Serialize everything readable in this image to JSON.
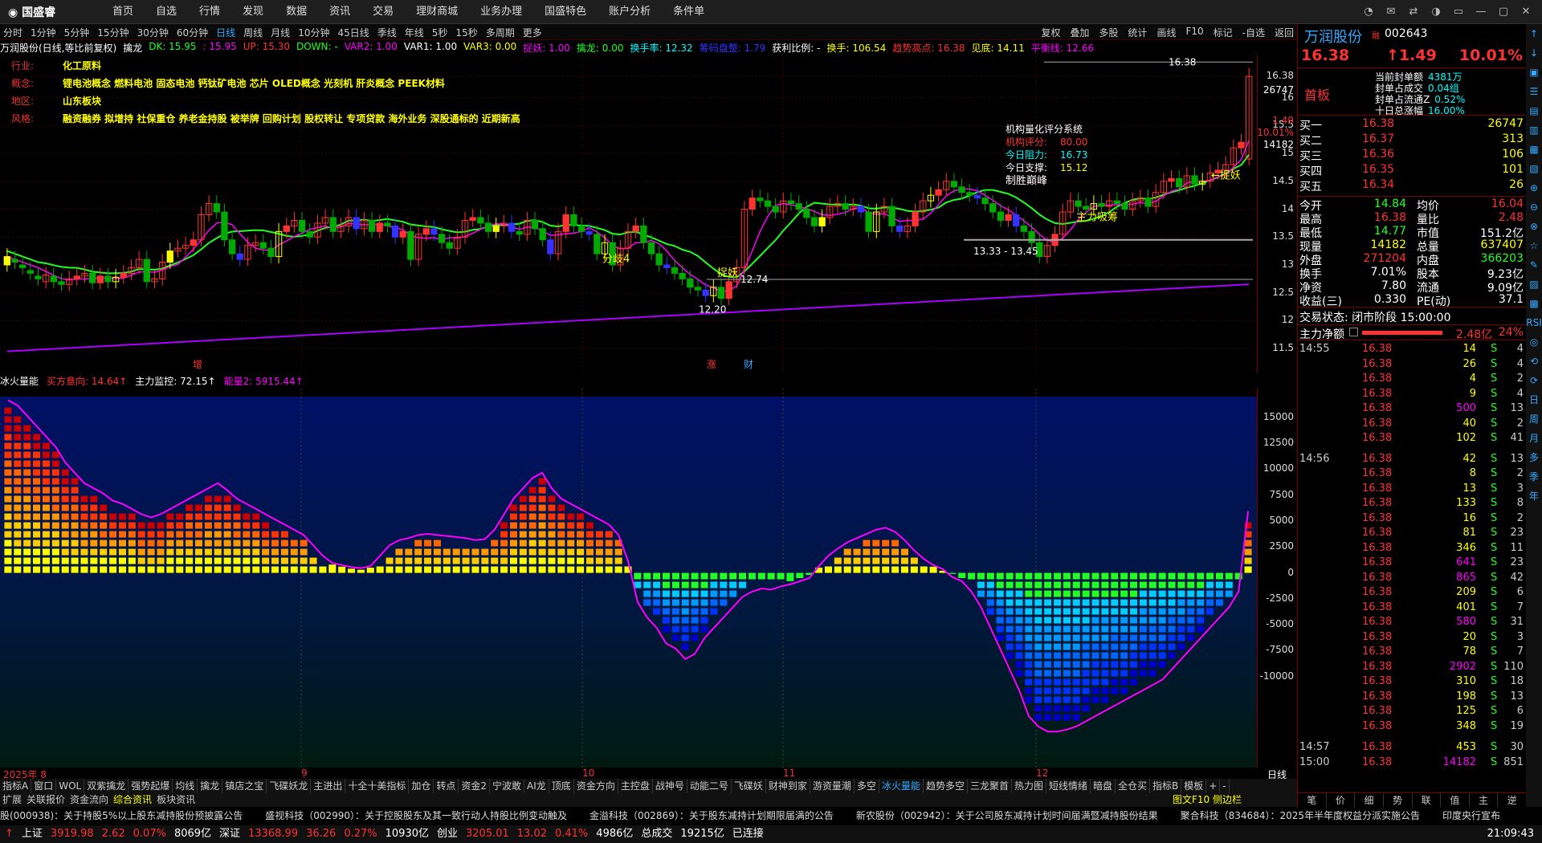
{
  "app": {
    "logo": "国盛睿",
    "menu": [
      "首页",
      "自选",
      "行情",
      "发现",
      "数据",
      "资讯",
      "交易",
      "理财商城",
      "业务办理",
      "国盛特色",
      "账户分析",
      "条件单"
    ],
    "win_icons": [
      "chat-icon",
      "mail-icon",
      "swap-icon",
      "skin-icon",
      "layout-icon",
      "minimize-icon",
      "maximize-icon",
      "close-icon"
    ]
  },
  "periods": {
    "items": [
      "分时",
      "1分钟",
      "5分钟",
      "15分钟",
      "30分钟",
      "60分钟",
      "日线",
      "周线",
      "月线",
      "10分钟",
      "45日线",
      "季线",
      "年线",
      "5秒",
      "15秒",
      "多周期",
      "更多"
    ],
    "active": "日线",
    "tools": [
      "复权",
      "叠加",
      "多股",
      "统计",
      "画线",
      "F10",
      "标记",
      "-自选",
      "返回"
    ]
  },
  "indline": [
    {
      "t": "万润股份(日线,等比前复权)",
      "c": "#fff"
    },
    {
      "t": "擒龙",
      "c": "#fff"
    },
    {
      "t": "DK: 15.95",
      "c": "#2f2"
    },
    {
      "t": ": 15.95",
      "c": "#f0f"
    },
    {
      "t": "UP: 15.30",
      "c": "#f33"
    },
    {
      "t": "DOWN: -",
      "c": "#2f2"
    },
    {
      "t": "VAR2: 1.00",
      "c": "#f0f"
    },
    {
      "t": "VAR1: 1.00",
      "c": "#fff"
    },
    {
      "t": "VAR3: 0.00",
      "c": "#ff0"
    },
    {
      "t": "捉妖: 1.00",
      "c": "#f0f"
    },
    {
      "t": "擒龙: 0.00",
      "c": "#2f2"
    },
    {
      "t": "换手率: 12.32",
      "c": "#0ff"
    },
    {
      "t": "筹码盘整: 1.79",
      "c": "#33f"
    },
    {
      "t": "获利比例: -",
      "c": "#fff"
    },
    {
      "t": "换手: 106.54",
      "c": "#ff0"
    },
    {
      "t": "趋势高点: 16.38",
      "c": "#f33"
    },
    {
      "t": "见底: 14.11",
      "c": "#ff0"
    },
    {
      "t": "平衡线: 12.66",
      "c": "#f0f"
    }
  ],
  "info": [
    {
      "k": "行业:",
      "v": "化工原料"
    },
    {
      "k": "概念:",
      "v": "锂电池概念 燃料电池 固态电池 钙钛矿电池 芯片 OLED概念 光刻机 肝炎概念 PEEK材料"
    },
    {
      "k": "地区:",
      "v": "山东板块"
    },
    {
      "k": "风格:",
      "v": "融资融券 拟增持 社保重仓 养老金持股 被举牌 回购计划 股权转让 专项贷款 海外业务 深股通标的 近期新高"
    }
  ],
  "rating": {
    "title": "机构量化评分系统",
    "l1": "机构评分:",
    "v1": "80.00",
    "l2": "今日阻力:",
    "v2": "16.73",
    "l3": "今日支撑:",
    "v3": "15.12",
    "l4": "制胜巅峰"
  },
  "annot": {
    "high": "16.38",
    "low1": "12.20",
    "low2": "12.74",
    "low3": "13.33 - 13.45",
    "zhuoyao": "捉妖",
    "fenqi": "分歧4",
    "zhuli": "主力吸筹",
    "zhuoyao2": "←捉妖",
    "zeng": "增",
    "zhang": "涨",
    "cai": "财"
  },
  "chart_data": [
    {
      "type": "candlestick",
      "title": "万润股份(日线,等比前复权)",
      "ylim": [
        11.2,
        16.6
      ],
      "yticks": [
        11.5,
        12.0,
        12.5,
        13.0,
        13.5,
        14.0,
        14.5,
        15.0,
        15.5,
        16.0,
        16.38
      ],
      "xlabels": [
        "2025年 8",
        "9",
        "10",
        "11",
        "12"
      ],
      "closes": [
        13.15,
        13.05,
        12.95,
        12.85,
        12.75,
        12.82,
        12.7,
        12.65,
        12.75,
        12.8,
        12.85,
        12.68,
        12.8,
        12.7,
        12.78,
        12.85,
        12.95,
        13.1,
        12.7,
        12.75,
        13.05,
        13.25,
        13.3,
        13.35,
        13.45,
        13.9,
        14.1,
        13.95,
        13.45,
        13.2,
        13.1,
        13.35,
        13.4,
        13.3,
        13.15,
        13.6,
        13.7,
        13.8,
        13.6,
        13.5,
        13.75,
        13.85,
        13.6,
        13.7,
        13.85,
        13.65,
        13.8,
        13.6,
        13.75,
        13.7,
        13.5,
        13.6,
        13.1,
        13.55,
        13.65,
        13.55,
        13.4,
        13.3,
        13.5,
        13.8,
        13.85,
        13.75,
        13.6,
        13.7,
        13.75,
        13.6,
        13.55,
        13.8,
        13.65,
        13.45,
        13.2,
        13.6,
        13.9,
        13.7,
        13.6,
        13.55,
        13.2,
        13.4,
        13.0,
        13.3,
        13.6,
        13.7,
        13.4,
        13.2,
        13.0,
        12.95,
        12.85,
        12.75,
        12.6,
        12.55,
        12.45,
        12.6,
        12.4,
        12.7,
        12.95,
        14.0,
        14.2,
        14.15,
        14.05,
        13.95,
        14.15,
        14.1,
        14.0,
        13.85,
        13.7,
        13.85,
        14.05,
        14.1,
        14.0,
        14.05,
        13.95,
        13.6,
        13.95,
        14.05,
        13.7,
        13.6,
        13.7,
        13.95,
        14.15,
        14.25,
        14.35,
        14.5,
        14.4,
        14.3,
        14.25,
        14.2,
        14.1,
        13.95,
        13.8,
        13.9,
        13.7,
        13.6,
        13.4,
        13.15,
        13.35,
        13.55,
        13.95,
        14.15,
        14.05,
        14.0,
        14.1,
        14.05,
        14.15,
        14.1,
        14.0,
        14.15,
        14.2,
        14.05,
        14.3,
        14.5,
        14.55,
        14.4,
        14.6,
        14.45,
        14.5,
        14.65,
        14.7,
        14.8,
        15.1,
        15.2,
        16.38
      ],
      "opens": [
        13.0,
        13.1,
        13.0,
        12.9,
        12.8,
        12.7,
        12.8,
        12.7,
        12.65,
        12.75,
        12.8,
        12.85,
        12.68,
        12.8,
        12.7,
        12.78,
        12.85,
        12.95,
        13.1,
        12.7,
        12.75,
        13.05,
        13.25,
        13.3,
        13.35,
        13.45,
        13.9,
        14.1,
        13.95,
        13.45,
        13.2,
        13.1,
        13.35,
        13.4,
        13.3,
        13.15,
        13.6,
        13.7,
        13.8,
        13.6,
        13.5,
        13.75,
        13.85,
        13.6,
        13.7,
        13.85,
        13.65,
        13.8,
        13.6,
        13.75,
        13.7,
        13.5,
        13.6,
        13.1,
        13.55,
        13.65,
        13.55,
        13.4,
        13.3,
        13.5,
        13.8,
        13.85,
        13.75,
        13.6,
        13.7,
        13.75,
        13.6,
        13.55,
        13.8,
        13.65,
        13.45,
        13.2,
        13.6,
        13.9,
        13.7,
        13.6,
        13.55,
        13.2,
        13.4,
        13.0,
        13.3,
        13.6,
        13.7,
        13.4,
        13.2,
        13.0,
        12.95,
        12.85,
        12.75,
        12.6,
        12.55,
        12.45,
        12.6,
        12.4,
        12.7,
        12.95,
        14.0,
        14.2,
        14.15,
        14.05,
        13.95,
        14.15,
        14.1,
        14.0,
        13.85,
        13.7,
        13.85,
        14.05,
        14.1,
        14.0,
        14.05,
        13.95,
        13.6,
        13.95,
        14.05,
        13.7,
        13.6,
        13.7,
        13.95,
        14.15,
        14.25,
        14.35,
        14.5,
        14.4,
        14.3,
        14.25,
        14.2,
        14.1,
        13.95,
        13.8,
        13.9,
        13.7,
        13.6,
        13.4,
        13.15,
        13.35,
        13.55,
        13.95,
        14.15,
        14.05,
        14.0,
        14.1,
        14.05,
        14.15,
        14.1,
        14.0,
        14.15,
        14.2,
        14.05,
        14.3,
        14.5,
        14.55,
        14.4,
        14.6,
        14.45,
        14.5,
        14.65,
        14.7,
        14.8,
        15.1,
        14.9
      ]
    },
    {
      "type": "bar",
      "title": "冰火量能",
      "series_labels": [
        {
          "t": "冰火量能",
          "c": "#fff"
        },
        {
          "t": "买方意向: 14.64↑",
          "c": "#f33"
        },
        {
          "t": "主力监控: 72.15↑",
          "c": "#fff"
        },
        {
          "t": "能量2: 5915.44↑",
          "c": "#f0f"
        }
      ],
      "ylim": [
        -18000,
        17000
      ],
      "yticks": [
        15000,
        12500,
        10000,
        7500,
        5000,
        2500,
        0,
        -2500,
        -5000,
        -7500,
        -10000
      ],
      "values": [
        16500,
        16000,
        15000,
        14000,
        13000,
        12000,
        10500,
        9500,
        8500,
        8000,
        7500,
        6800,
        6500,
        6000,
        5500,
        5200,
        5500,
        6000,
        6500,
        7000,
        7500,
        8000,
        8500,
        7800,
        7000,
        6500,
        6000,
        5500,
        5000,
        4500,
        4000,
        3500,
        2500,
        1500,
        800,
        600,
        400,
        300,
        500,
        1500,
        2500,
        3000,
        3200,
        3500,
        3600,
        3500,
        3400,
        3300,
        3200,
        3000,
        3100,
        4000,
        5500,
        7000,
        8000,
        9000,
        9500,
        8000,
        7000,
        6500,
        6000,
        5500,
        5000,
        4500,
        3500,
        1000,
        -2500,
        -4000,
        -5000,
        -6500,
        -7000,
        -8000,
        -7500,
        -6000,
        -5000,
        -4000,
        -3000,
        -2000,
        -1500,
        -1200,
        -1300,
        -1000,
        -800,
        -500,
        -200,
        500,
        1500,
        2200,
        2800,
        3200,
        3600,
        4000,
        4200,
        3800,
        3000,
        2000,
        1200,
        600,
        200,
        -100,
        -500,
        -1500,
        -3000,
        -5000,
        -7000,
        -9000,
        -11000,
        -13500,
        -14500,
        -15000,
        -15000,
        -14800,
        -14500,
        -14000,
        -13500,
        -13000,
        -12500,
        -12000,
        -11500,
        -11000,
        -10500,
        -10000,
        -9000,
        -8000,
        -7000,
        -6000,
        -5000,
        -4000,
        -3000,
        -1500,
        5800
      ]
    }
  ],
  "datebar": [
    "2025年 8",
    "9",
    "10",
    "11",
    "12"
  ],
  "tabs1": [
    "指标A",
    "窗口",
    "WOL",
    "双紫擒龙",
    "强势起爆",
    "均线",
    "擒龙",
    "镇店之宝",
    "飞碟妖龙",
    "主进出",
    "十全十美指标",
    "加仓",
    "转点",
    "资金2",
    "宁波敢",
    "AI龙",
    "顶底",
    "资金方向",
    "主控盘",
    "战神号",
    "动能二号",
    "飞碟妖",
    "财神到家",
    "游资量潮",
    "多空",
    "冰火量能",
    "趋势多空",
    "三龙聚首",
    "热力图",
    "短线情绪",
    "暗盘",
    "全仓买",
    "指标B",
    "模板",
    "+",
    "-"
  ],
  "tabs1_active": "冰火量能",
  "tabs2": [
    "扩展",
    "关联报价",
    "资金流向",
    "综合资讯",
    "板块资讯"
  ],
  "tabs2_active": "综合资讯",
  "tabs2_right": "图文F10 侧边栏",
  "news": [
    "股(000938)：关于持股5%以上股东减持股份预披露公告",
    "盛视科技（002990）：关于控股股东及其一致行动人持股比例变动触及",
    "金溢科技（002869）：关于股东减持计划期限届满的公告",
    "新农股份（002942）：关于公司股东减持计划时间届满暨减持股份结果",
    "聚合科技（834684）：2025年半年度权益分派实施公告",
    "印度央行宣布"
  ],
  "status": [
    {
      "t": "上证",
      "c": "#fff"
    },
    {
      "t": "3919.98",
      "c": "#f33"
    },
    {
      "t": "2.62",
      "c": "#f33"
    },
    {
      "t": "0.07%",
      "c": "#f33"
    },
    {
      "t": "8069亿",
      "c": "#fff"
    },
    {
      "t": "深证",
      "c": "#fff"
    },
    {
      "t": "13368.99",
      "c": "#f33"
    },
    {
      "t": "36.26",
      "c": "#f33"
    },
    {
      "t": "0.27%",
      "c": "#f33"
    },
    {
      "t": "10930亿",
      "c": "#fff"
    },
    {
      "t": "创业",
      "c": "#fff"
    },
    {
      "t": "3205.01",
      "c": "#f33"
    },
    {
      "t": "13.02",
      "c": "#f33"
    },
    {
      "t": "0.41%",
      "c": "#f33"
    },
    {
      "t": "4986亿",
      "c": "#fff"
    },
    {
      "t": "总成交",
      "c": "#fff"
    },
    {
      "t": "19215亿",
      "c": "#fff"
    },
    {
      "t": "已连接",
      "c": "#fff"
    }
  ],
  "clock": "21:09:43",
  "stock": {
    "name": "万润股份",
    "code": "002643",
    "tag": "融",
    "price": "16.38",
    "change": "1.49",
    "pct": "10.01%",
    "board": "首板",
    "seal": [
      {
        "k": "当前封单额",
        "v": "4381万"
      },
      {
        "k": "封单占成交",
        "v": "0.04组"
      },
      {
        "k": "封单占流通Z",
        "v": "0.52%"
      },
      {
        "k": "十日总涨幅",
        "v": "16.00%"
      }
    ],
    "buys": [
      {
        "k": "买一",
        "p": "16.38",
        "v": "26747"
      },
      {
        "k": "买二",
        "p": "16.37",
        "v": "313"
      },
      {
        "k": "买三",
        "p": "16.36",
        "v": "106"
      },
      {
        "k": "买四",
        "p": "16.35",
        "v": "101"
      },
      {
        "k": "买五",
        "p": "16.34",
        "v": "26"
      }
    ],
    "stats": [
      {
        "k1": "今开",
        "v1": "14.84",
        "k2": "均价",
        "v2": "16.04",
        "c1": "#2f2",
        "c2": "#f33"
      },
      {
        "k1": "最高",
        "v1": "16.38",
        "k2": "量比",
        "v2": "2.48",
        "c1": "#f33",
        "c2": "#f33"
      },
      {
        "k1": "最低",
        "v1": "14.77",
        "k2": "市值",
        "v2": "151.2亿",
        "c1": "#2f2",
        "c2": "#fff"
      },
      {
        "k1": "现量",
        "v1": "14182",
        "k2": "总量",
        "v2": "637407",
        "c1": "#ff0",
        "c2": "#ff0"
      },
      {
        "k1": "外盘",
        "v1": "271204",
        "k2": "内盘",
        "v2": "366203",
        "c1": "#f33",
        "c2": "#2f2"
      },
      {
        "k1": "换手",
        "v1": "7.01%",
        "k2": "股本",
        "v2": "9.23亿",
        "c1": "#fff",
        "c2": "#fff"
      },
      {
        "k1": "净资",
        "v1": "7.80",
        "k2": "流通",
        "v2": "9.09亿",
        "c1": "#fff",
        "c2": "#fff"
      },
      {
        "k1": "收益(三)",
        "v1": "0.330",
        "k2": "PE(动)",
        "v2": "37.1",
        "c1": "#fff",
        "c2": "#fff"
      }
    ],
    "trade_state": "交易状态: 闭市阶段 15:00:00",
    "mainflow_label": "主力净额",
    "mainflow": "2.48亿",
    "mainflow_pct": "24%",
    "ticks": [
      {
        "t": "14:55",
        "p": "16.38",
        "v": "14",
        "s": "S",
        "n": "4"
      },
      {
        "t": "",
        "p": "16.38",
        "v": "26",
        "s": "S",
        "n": "4"
      },
      {
        "t": "",
        "p": "16.38",
        "v": "4",
        "s": "S",
        "n": "2"
      },
      {
        "t": "",
        "p": "16.38",
        "v": "9",
        "s": "S",
        "n": "4"
      },
      {
        "t": "",
        "p": "16.38",
        "v": "500",
        "s": "S",
        "n": "13"
      },
      {
        "t": "",
        "p": "16.38",
        "v": "40",
        "s": "S",
        "n": "2"
      },
      {
        "t": "",
        "p": "16.38",
        "v": "102",
        "s": "S",
        "n": "41"
      },
      {
        "t": "14:56",
        "p": "16.38",
        "v": "42",
        "s": "S",
        "n": "13"
      },
      {
        "t": "",
        "p": "16.38",
        "v": "8",
        "s": "S",
        "n": "2"
      },
      {
        "t": "",
        "p": "16.38",
        "v": "13",
        "s": "S",
        "n": "3"
      },
      {
        "t": "",
        "p": "16.38",
        "v": "133",
        "s": "S",
        "n": "8"
      },
      {
        "t": "",
        "p": "16.38",
        "v": "16",
        "s": "S",
        "n": "2"
      },
      {
        "t": "",
        "p": "16.38",
        "v": "81",
        "s": "S",
        "n": "23"
      },
      {
        "t": "",
        "p": "16.38",
        "v": "346",
        "s": "S",
        "n": "11"
      },
      {
        "t": "",
        "p": "16.38",
        "v": "641",
        "s": "S",
        "n": "23"
      },
      {
        "t": "",
        "p": "16.38",
        "v": "865",
        "s": "S",
        "n": "42"
      },
      {
        "t": "",
        "p": "16.38",
        "v": "209",
        "s": "S",
        "n": "6"
      },
      {
        "t": "",
        "p": "16.38",
        "v": "401",
        "s": "S",
        "n": "7"
      },
      {
        "t": "",
        "p": "16.38",
        "v": "580",
        "s": "S",
        "n": "31"
      },
      {
        "t": "",
        "p": "16.38",
        "v": "20",
        "s": "S",
        "n": "3"
      },
      {
        "t": "",
        "p": "16.38",
        "v": "78",
        "s": "S",
        "n": "7"
      },
      {
        "t": "",
        "p": "16.38",
        "v": "2902",
        "s": "S",
        "n": "110"
      },
      {
        "t": "",
        "p": "16.38",
        "v": "310",
        "s": "S",
        "n": "18"
      },
      {
        "t": "",
        "p": "16.38",
        "v": "198",
        "s": "S",
        "n": "13"
      },
      {
        "t": "",
        "p": "16.38",
        "v": "125",
        "s": "S",
        "n": "6"
      },
      {
        "t": "",
        "p": "16.38",
        "v": "348",
        "s": "S",
        "n": "19"
      },
      {
        "t": "14:57",
        "p": "16.38",
        "v": "453",
        "s": "S",
        "n": "30"
      },
      {
        "t": "15:00",
        "p": "16.38",
        "v": "14182",
        "s": "S",
        "n": "851"
      }
    ],
    "bottom_tabs": [
      "笔",
      "价",
      "细",
      "势",
      "联",
      "值",
      "主",
      "逆"
    ]
  },
  "rtoolbar": [
    "↑",
    "↓",
    "▣",
    "☰",
    "▤",
    "▥",
    "▦",
    "▧",
    "⊕",
    "⊖",
    "⊗",
    "☆",
    "✎",
    "▨",
    "▩",
    "RSI",
    "◎",
    "⟲",
    "⟳",
    "日",
    "周",
    "月",
    "多",
    "季",
    "年"
  ]
}
